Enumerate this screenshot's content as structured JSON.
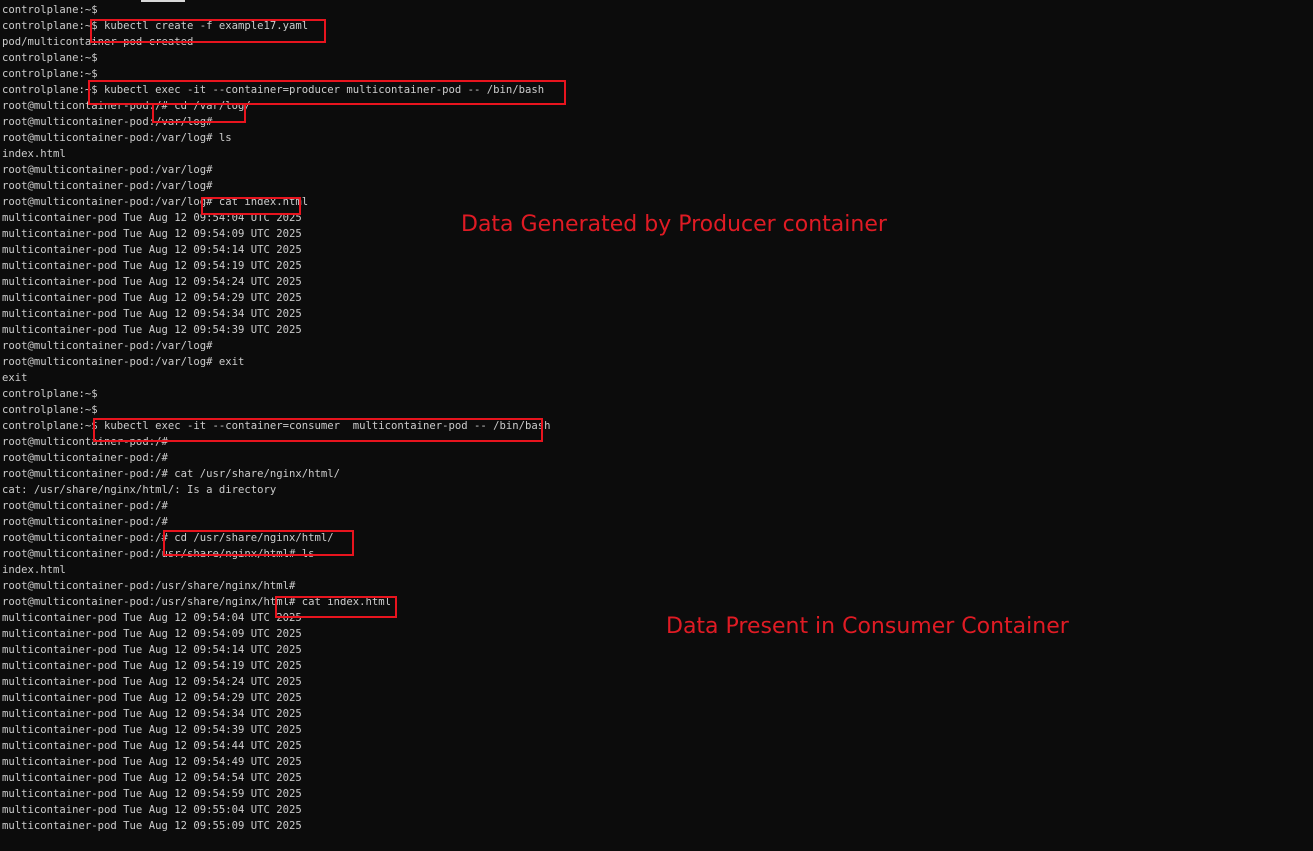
{
  "terminal": {
    "lines": [
      "controlplane:~$",
      "controlplane:~$ kubectl create -f example17.yaml",
      "pod/multicontainer-pod created",
      "controlplane:~$",
      "controlplane:~$",
      "controlplane:~$ kubectl exec -it --container=producer multicontainer-pod -- /bin/bash",
      "root@multicontainer-pod:/# cd /var/log/",
      "root@multicontainer-pod:/var/log#",
      "root@multicontainer-pod:/var/log# ls",
      "index.html",
      "root@multicontainer-pod:/var/log#",
      "root@multicontainer-pod:/var/log#",
      "root@multicontainer-pod:/var/log# cat index.html",
      "multicontainer-pod Tue Aug 12 09:54:04 UTC 2025",
      "multicontainer-pod Tue Aug 12 09:54:09 UTC 2025",
      "multicontainer-pod Tue Aug 12 09:54:14 UTC 2025",
      "multicontainer-pod Tue Aug 12 09:54:19 UTC 2025",
      "multicontainer-pod Tue Aug 12 09:54:24 UTC 2025",
      "multicontainer-pod Tue Aug 12 09:54:29 UTC 2025",
      "multicontainer-pod Tue Aug 12 09:54:34 UTC 2025",
      "multicontainer-pod Tue Aug 12 09:54:39 UTC 2025",
      "root@multicontainer-pod:/var/log#",
      "root@multicontainer-pod:/var/log# exit",
      "exit",
      "controlplane:~$",
      "controlplane:~$",
      "controlplane:~$ kubectl exec -it --container=consumer  multicontainer-pod -- /bin/bash",
      "root@multicontainer-pod:/#",
      "root@multicontainer-pod:/#",
      "root@multicontainer-pod:/# cat /usr/share/nginx/html/",
      "cat: /usr/share/nginx/html/: Is a directory",
      "root@multicontainer-pod:/#",
      "root@multicontainer-pod:/#",
      "root@multicontainer-pod:/# cd /usr/share/nginx/html/",
      "root@multicontainer-pod:/usr/share/nginx/html# ls",
      "index.html",
      "root@multicontainer-pod:/usr/share/nginx/html#",
      "root@multicontainer-pod:/usr/share/nginx/html# cat index.html",
      "multicontainer-pod Tue Aug 12 09:54:04 UTC 2025",
      "multicontainer-pod Tue Aug 12 09:54:09 UTC 2025",
      "multicontainer-pod Tue Aug 12 09:54:14 UTC 2025",
      "multicontainer-pod Tue Aug 12 09:54:19 UTC 2025",
      "multicontainer-pod Tue Aug 12 09:54:24 UTC 2025",
      "multicontainer-pod Tue Aug 12 09:54:29 UTC 2025",
      "multicontainer-pod Tue Aug 12 09:54:34 UTC 2025",
      "multicontainer-pod Tue Aug 12 09:54:39 UTC 2025",
      "multicontainer-pod Tue Aug 12 09:54:44 UTC 2025",
      "multicontainer-pod Tue Aug 12 09:54:49 UTC 2025",
      "multicontainer-pod Tue Aug 12 09:54:54 UTC 2025",
      "multicontainer-pod Tue Aug 12 09:54:59 UTC 2025",
      "multicontainer-pod Tue Aug 12 09:55:04 UTC 2025",
      "multicontainer-pod Tue Aug 12 09:55:09 UTC 2025"
    ]
  },
  "annotations": {
    "producer_note": "Data Generated by Producer container",
    "consumer_note": "Data Present in Consumer Container"
  },
  "colors": {
    "background": "#0c0c0c",
    "text": "#cccccc",
    "highlight": "#e8141e",
    "annotation": "#e01b24"
  }
}
